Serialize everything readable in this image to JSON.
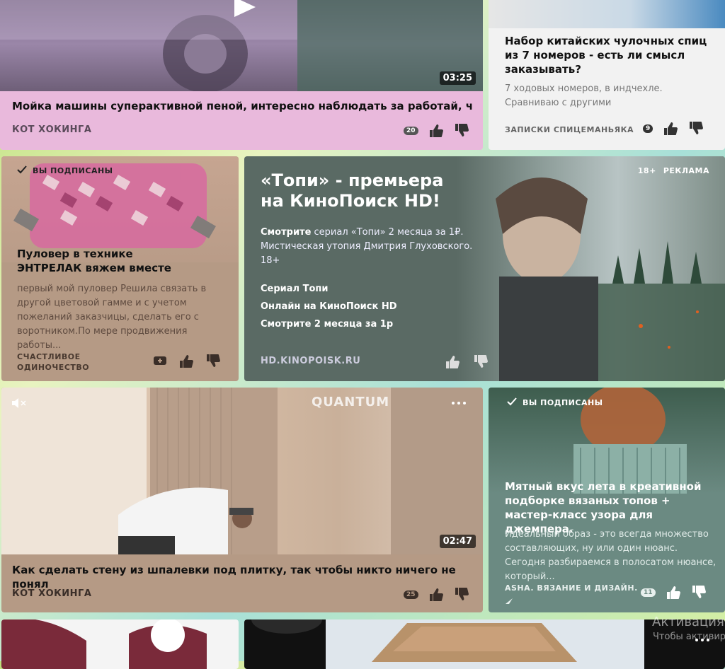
{
  "cards": {
    "car_wash": {
      "duration": "03:25",
      "title": "Мойка машины суперактивной пеной, интересно наблюдать за работай, что не...",
      "source": "КОТ ХОКИНГА",
      "comments": "20",
      "bg_color": "#e9b9dc"
    },
    "needles": {
      "title": "Набор китайских чулочных спиц из 7 номеров - есть ли смысл заказывать?",
      "description": "7 ходовых номеров, в индчехле. Сравниваю с другими",
      "source": "ЗАПИСКИ СПИЦЕМАНЬЯКА",
      "comments": "9"
    },
    "pullover": {
      "subscribed": "ВЫ ПОДПИСАНЫ",
      "title": "Пуловер в технике ЭНТРЕЛАК вяжем вместе",
      "description": "первый мой пуловер Решила связать в другой цветовой гамме и с учетом пожеланий заказчицы, сделать его с воротником.По мере продвижения работы...",
      "source": "СЧАСТЛИВОЕ ОДИНОЧЕСТВО"
    },
    "ad": {
      "age_badge": "18+",
      "ad_label": "РЕКЛАМА",
      "headline": "«Топи» - премьера на КиноПоиск HD!",
      "body_strong": "Смотрите",
      "body_rest": " сериал «Топи» 2 месяца за 1₽. Мистическая утопия Дмитрия Глуховского. 18+",
      "links": [
        "Сериал Топи",
        "Онлайн на КиноПоиск HD",
        "Смотрите 2 месяца за 1р"
      ],
      "domain": "HD.KINOPOISK.RU",
      "bg_color": "#5a6a64"
    },
    "wall": {
      "watermark": "QUANTUM",
      "duration": "02:47",
      "title": "Как сделать стену из шпалевки под плитку, так чтобы никто ничего не понял",
      "source": "КОТ ХОКИНГА",
      "comments": "25",
      "bg_color": "#b59a85"
    },
    "mint": {
      "subscribed": "ВЫ ПОДПИСАНЫ",
      "title": "Мятный вкус лета в креативной подборке вязаных топов + мастер-класс узора для джемпера.",
      "description": "Идеальный образ - это всегда множество составляющих, ну или один нюанс. Сегодня разбираемся в полосатом нюансе, который...",
      "source": "ASHA. ВЯЗАНИЕ И ДИЗАЙН.",
      "comments": "11",
      "bg_color": "#6b8a82"
    }
  },
  "overlay": {
    "activation_title": "Активация",
    "activation_sub": "Чтобы активир"
  }
}
